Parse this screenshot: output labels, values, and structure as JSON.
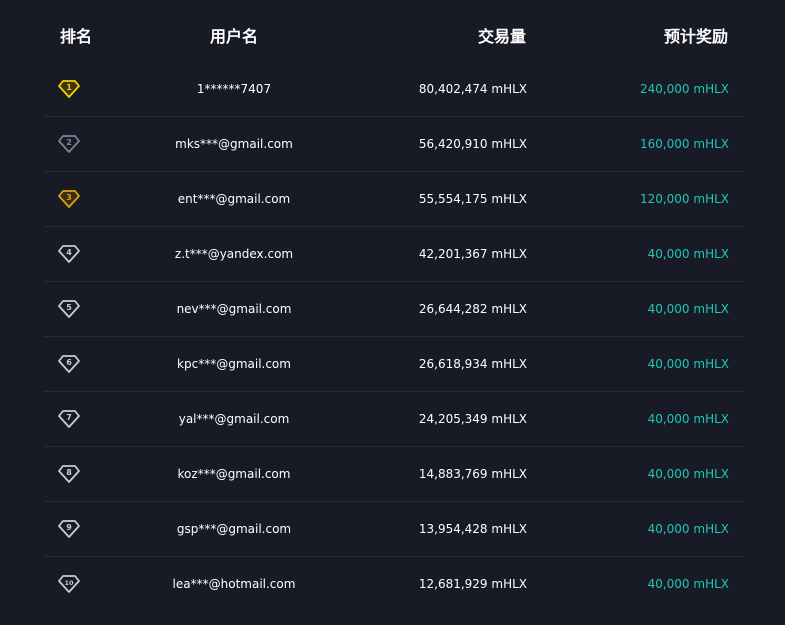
{
  "header": {
    "rank": "排名",
    "username": "用户名",
    "volume": "交易量",
    "reward": "预计奖励"
  },
  "colors": {
    "background": "#181a25",
    "reward_text": "#1ec8b9",
    "rank1": "#f0d300",
    "rank2": "#7d8696",
    "rank3": "#d9a414",
    "rank_other": "#c9ccd3"
  },
  "rows": [
    {
      "rank": "1",
      "icon": "gold-diamond-badge-icon",
      "user": "1******7407",
      "volume": "80,402,474 mHLX",
      "reward": "240,000 mHLX"
    },
    {
      "rank": "2",
      "icon": "silver-diamond-badge-icon",
      "user": "mks***@gmail.com",
      "volume": "56,420,910 mHLX",
      "reward": "160,000 mHLX"
    },
    {
      "rank": "3",
      "icon": "bronze-diamond-badge-icon",
      "user": "ent***@gmail.com",
      "volume": "55,554,175 mHLX",
      "reward": "120,000 mHLX"
    },
    {
      "rank": "4",
      "icon": "diamond-badge-icon",
      "user": "z.t***@yandex.com",
      "volume": "42,201,367 mHLX",
      "reward": "40,000 mHLX"
    },
    {
      "rank": "5",
      "icon": "diamond-badge-icon",
      "user": "nev***@gmail.com",
      "volume": "26,644,282 mHLX",
      "reward": "40,000 mHLX"
    },
    {
      "rank": "6",
      "icon": "diamond-badge-icon",
      "user": "kpc***@gmail.com",
      "volume": "26,618,934 mHLX",
      "reward": "40,000 mHLX"
    },
    {
      "rank": "7",
      "icon": "diamond-badge-icon",
      "user": "yal***@gmail.com",
      "volume": "24,205,349 mHLX",
      "reward": "40,000 mHLX"
    },
    {
      "rank": "8",
      "icon": "diamond-badge-icon",
      "user": "koz***@gmail.com",
      "volume": "14,883,769 mHLX",
      "reward": "40,000 mHLX"
    },
    {
      "rank": "9",
      "icon": "diamond-badge-icon",
      "user": "gsp***@gmail.com",
      "volume": "13,954,428 mHLX",
      "reward": "40,000 mHLX"
    },
    {
      "rank": "10",
      "icon": "diamond-badge-icon",
      "user": "lea***@hotmail.com",
      "volume": "12,681,929 mHLX",
      "reward": "40,000 mHLX"
    }
  ]
}
